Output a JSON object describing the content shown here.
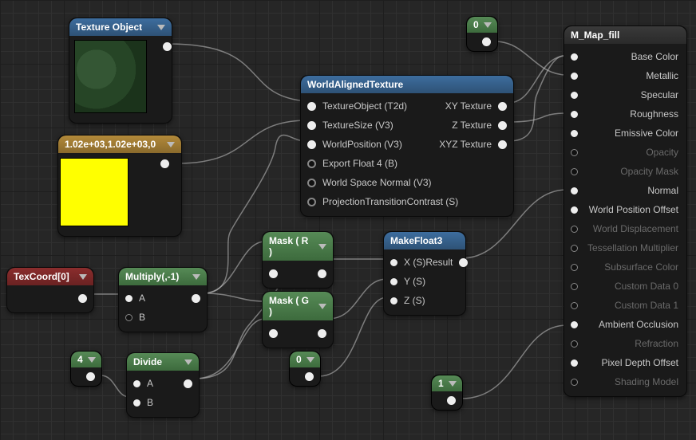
{
  "chart_data": null,
  "nodes": {
    "texture_object": {
      "title": "Texture Object"
    },
    "vec3_const": {
      "title": "1.02e+03,1.02e+03,0"
    },
    "world_aligned": {
      "title": "WorldAlignedTexture",
      "inputs": [
        "TextureObject (T2d)",
        "TextureSize (V3)",
        "WorldPosition (V3)",
        "Export Float 4 (B)",
        "World Space Normal (V3)",
        "ProjectionTransitionContrast (S)"
      ],
      "outputs": [
        "XY Texture",
        "Z Texture",
        "XYZ Texture"
      ]
    },
    "mask_r": {
      "title": "Mask ( R )"
    },
    "mask_g": {
      "title": "Mask ( G )"
    },
    "texcoord": {
      "title": "TexCoord[0]"
    },
    "multiply": {
      "title": "Multiply(,-1)",
      "inputs": [
        "A",
        "B"
      ]
    },
    "divide": {
      "title": "Divide",
      "inputs": [
        "A",
        "B"
      ]
    },
    "makefloat3": {
      "title": "MakeFloat3",
      "inputs": [
        "X (S)",
        "Y (S)",
        "Z (S)"
      ],
      "output": "Result"
    },
    "const_0a": {
      "title": "0"
    },
    "const_0b": {
      "title": "0"
    },
    "const_4": {
      "title": "4"
    },
    "const_1": {
      "title": "1"
    }
  },
  "material_output": {
    "title": "M_Map_fill",
    "pins": [
      {
        "label": "Base Color",
        "active": true
      },
      {
        "label": "Metallic",
        "active": true
      },
      {
        "label": "Specular",
        "active": true
      },
      {
        "label": "Roughness",
        "active": true
      },
      {
        "label": "Emissive Color",
        "active": true
      },
      {
        "label": "Opacity",
        "active": false
      },
      {
        "label": "Opacity Mask",
        "active": false
      },
      {
        "label": "Normal",
        "active": true
      },
      {
        "label": "World Position Offset",
        "active": true
      },
      {
        "label": "World Displacement",
        "active": false
      },
      {
        "label": "Tessellation Multiplier",
        "active": false
      },
      {
        "label": "Subsurface Color",
        "active": false
      },
      {
        "label": "Custom Data 0",
        "active": false
      },
      {
        "label": "Custom Data 1",
        "active": false
      },
      {
        "label": "Ambient Occlusion",
        "active": true
      },
      {
        "label": "Refraction",
        "active": false
      },
      {
        "label": "Pixel Depth Offset",
        "active": true
      },
      {
        "label": "Shading Model",
        "active": false
      }
    ]
  }
}
